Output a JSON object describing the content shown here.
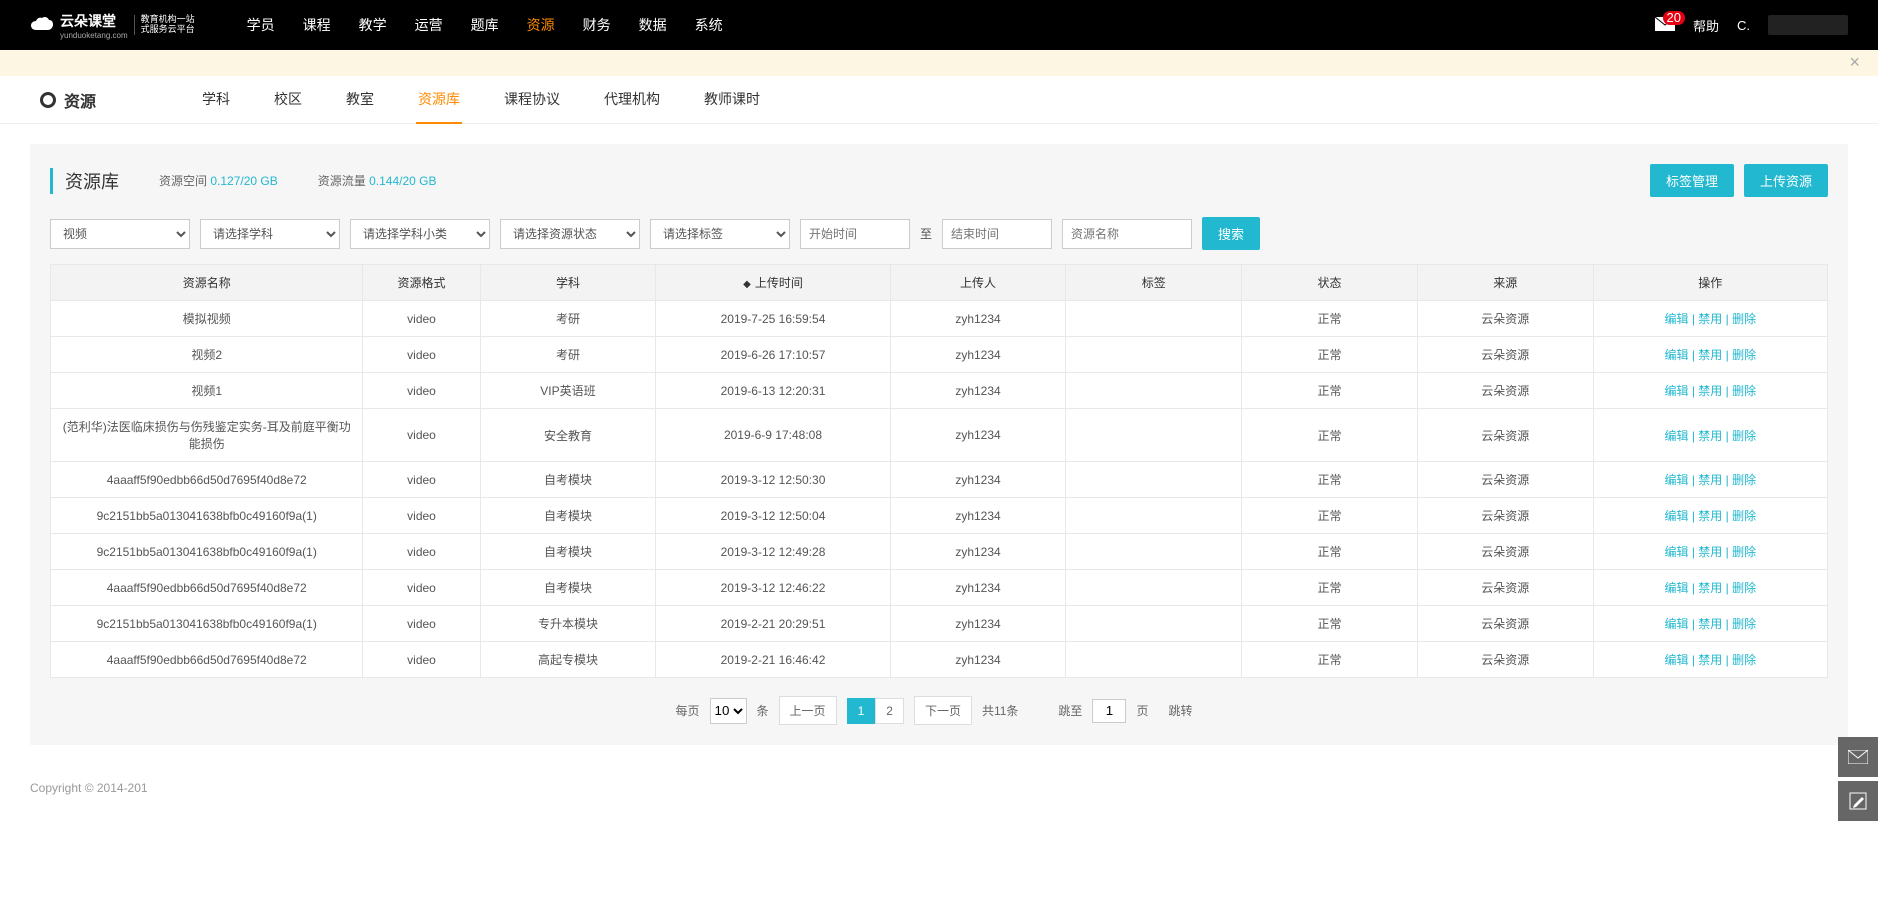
{
  "topnav": {
    "logo_main": "云朵课堂",
    "logo_sub_line1": "教育机构一站",
    "logo_sub_line2": "式服务云平台",
    "logo_domain": "yunduoketang.com",
    "menu": [
      "学员",
      "课程",
      "教学",
      "运营",
      "题库",
      "资源",
      "财务",
      "数据",
      "系统"
    ],
    "active_index": 5,
    "badge_count": "20",
    "help": "帮助",
    "user_prefix": "C."
  },
  "subnav": {
    "title": "资源",
    "menu": [
      "学科",
      "校区",
      "教室",
      "资源库",
      "课程协议",
      "代理机构",
      "教师课时"
    ],
    "active_index": 3
  },
  "panel": {
    "title": "资源库",
    "space_label": "资源空间",
    "space_value": "0.127/20 GB",
    "flow_label": "资源流量",
    "flow_value": "0.144/20 GB",
    "btn_tag": "标签管理",
    "btn_upload": "上传资源"
  },
  "filters": {
    "type_value": "视频",
    "subject_placeholder": "请选择学科",
    "subcat_placeholder": "请选择学科小类",
    "status_placeholder": "请选择资源状态",
    "tag_placeholder": "请选择标签",
    "start_placeholder": "开始时间",
    "to_word": "至",
    "end_placeholder": "结束时间",
    "name_placeholder": "资源名称",
    "search_btn": "搜索"
  },
  "table": {
    "headers": [
      "资源名称",
      "资源格式",
      "学科",
      "上传时间",
      "上传人",
      "标签",
      "状态",
      "来源",
      "操作"
    ],
    "sort_col_index": 3,
    "actions": {
      "edit": "编辑",
      "disable": "禁用",
      "delete": "删除"
    },
    "rows": [
      {
        "name": "模拟视频",
        "format": "video",
        "subject": "考研",
        "time": "2019-7-25 16:59:54",
        "uploader": "zyh1234",
        "tag": "",
        "status": "正常",
        "source": "云朵资源"
      },
      {
        "name": "视频2",
        "format": "video",
        "subject": "考研",
        "time": "2019-6-26 17:10:57",
        "uploader": "zyh1234",
        "tag": "",
        "status": "正常",
        "source": "云朵资源"
      },
      {
        "name": "视频1",
        "format": "video",
        "subject": "VIP英语班",
        "time": "2019-6-13 12:20:31",
        "uploader": "zyh1234",
        "tag": "",
        "status": "正常",
        "source": "云朵资源"
      },
      {
        "name": "(范利华)法医临床损伤与伤残鉴定实务-耳及前庭平衡功能损伤",
        "format": "video",
        "subject": "安全教育",
        "time": "2019-6-9 17:48:08",
        "uploader": "zyh1234",
        "tag": "",
        "status": "正常",
        "source": "云朵资源"
      },
      {
        "name": "4aaaff5f90edbb66d50d7695f40d8e72",
        "format": "video",
        "subject": "自考模块",
        "time": "2019-3-12 12:50:30",
        "uploader": "zyh1234",
        "tag": "",
        "status": "正常",
        "source": "云朵资源"
      },
      {
        "name": "9c2151bb5a013041638bfb0c49160f9a(1)",
        "format": "video",
        "subject": "自考模块",
        "time": "2019-3-12 12:50:04",
        "uploader": "zyh1234",
        "tag": "",
        "status": "正常",
        "source": "云朵资源"
      },
      {
        "name": "9c2151bb5a013041638bfb0c49160f9a(1)",
        "format": "video",
        "subject": "自考模块",
        "time": "2019-3-12 12:49:28",
        "uploader": "zyh1234",
        "tag": "",
        "status": "正常",
        "source": "云朵资源"
      },
      {
        "name": "4aaaff5f90edbb66d50d7695f40d8e72",
        "format": "video",
        "subject": "自考模块",
        "time": "2019-3-12 12:46:22",
        "uploader": "zyh1234",
        "tag": "",
        "status": "正常",
        "source": "云朵资源"
      },
      {
        "name": "9c2151bb5a013041638bfb0c49160f9a(1)",
        "format": "video",
        "subject": "专升本模块",
        "time": "2019-2-21 20:29:51",
        "uploader": "zyh1234",
        "tag": "",
        "status": "正常",
        "source": "云朵资源"
      },
      {
        "name": "4aaaff5f90edbb66d50d7695f40d8e72",
        "format": "video",
        "subject": "高起专模块",
        "time": "2019-2-21 16:46:42",
        "uploader": "zyh1234",
        "tag": "",
        "status": "正常",
        "source": "云朵资源"
      }
    ]
  },
  "pager": {
    "per_page_label": "每页",
    "per_page_value": "10",
    "unit": "条",
    "prev": "上一页",
    "pages": [
      "1",
      "2"
    ],
    "active_page_index": 0,
    "next": "下一页",
    "total": "共11条",
    "jump_label": "跳至",
    "jump_value": "1",
    "page_word": "页",
    "jump_btn": "跳转"
  },
  "footer": {
    "copyright": "Copyright © 2014-201"
  }
}
